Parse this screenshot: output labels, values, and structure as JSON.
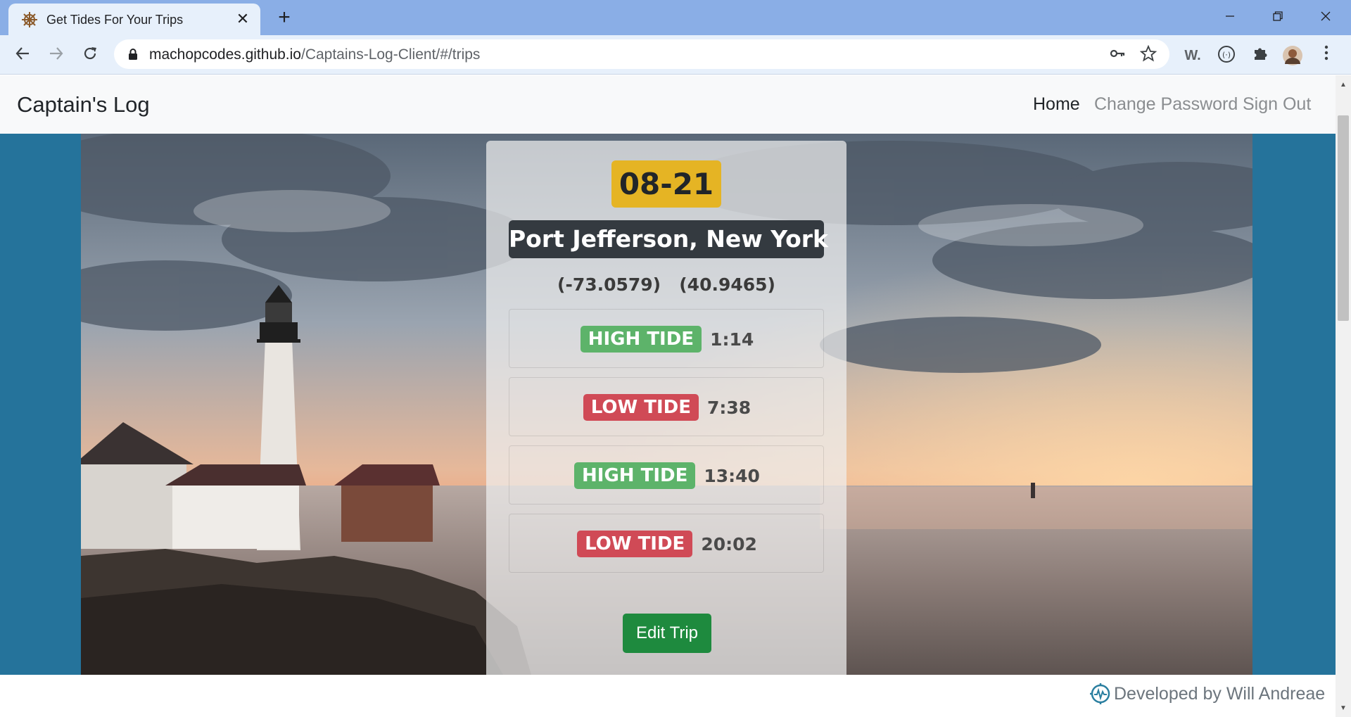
{
  "browser": {
    "tab_title": "Get Tides For Your Trips",
    "tab_close": "✕",
    "new_tab": "+",
    "url_host": "machopcodes.github.io",
    "url_path": "/Captains-Log-Client/#/trips",
    "ext_w_label": "W."
  },
  "navbar": {
    "brand": "Captain's Log",
    "links": [
      "Home",
      "Change Password",
      "Sign Out"
    ],
    "active_link": "Home"
  },
  "trip": {
    "date": "08-21",
    "location": "Port Jefferson, New York",
    "longitude": "(-73.0579)",
    "latitude": "(40.9465)",
    "tides": [
      {
        "type": "HIGH TIDE",
        "kind": "high",
        "time": "1:14"
      },
      {
        "type": "LOW TIDE",
        "kind": "low",
        "time": "7:38"
      },
      {
        "type": "HIGH TIDE",
        "kind": "high",
        "time": "13:40"
      },
      {
        "type": "LOW TIDE",
        "kind": "low",
        "time": "20:02"
      }
    ],
    "edit_label": "Edit Trip"
  },
  "footer": {
    "text": "Developed by Will Andreae"
  },
  "colors": {
    "hero_bg": "#25739b",
    "date_badge": "#e5b424",
    "location_badge": "#343a40",
    "high_tide": "#5db36a",
    "low_tide": "#d04a56",
    "edit_button": "#1e8a3e"
  }
}
